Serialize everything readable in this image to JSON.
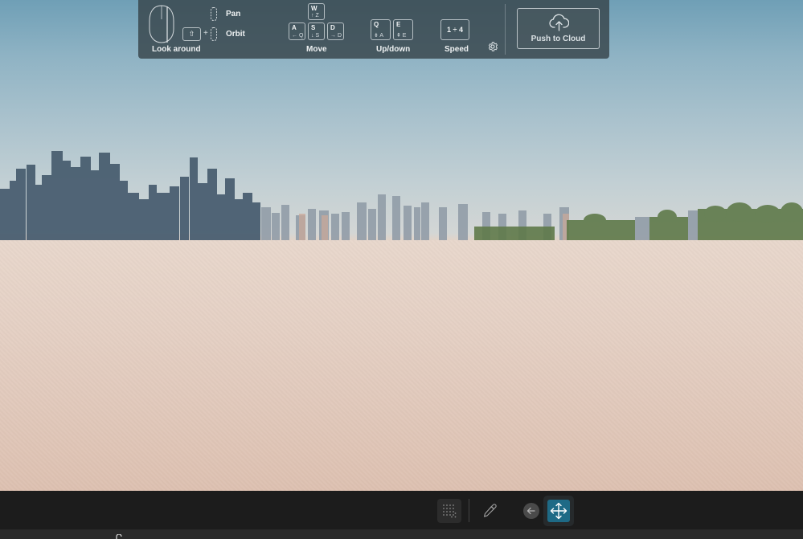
{
  "controls": {
    "look_around_label": "Look around",
    "pan_label": "Pan",
    "orbit_label": "Orbit",
    "plus_sign": "+",
    "modifier_glyph": "⇧",
    "move_label": "Move",
    "updown_label": "Up/down",
    "speed_label": "Speed",
    "keys": {
      "w": {
        "top": "W",
        "bottom": "↑ Z"
      },
      "a": {
        "top": "A",
        "bottom": "← Q"
      },
      "s": {
        "top": "S",
        "bottom": "↓ S"
      },
      "d": {
        "top": "D",
        "bottom": "→ D"
      },
      "q": {
        "top": "Q",
        "bottom": "⇟   A"
      },
      "e": {
        "top": "E",
        "bottom": "⇞      E"
      }
    },
    "speed_range": "1 ÷ 4",
    "settings_icon": "gear-icon",
    "push_to_cloud": {
      "label": "Push to Cloud",
      "icon": "cloud-upload-icon"
    }
  },
  "toolbar": {
    "items": [
      {
        "icon": "grid-dots-icon",
        "active": false
      },
      {
        "icon": "eyedropper-icon",
        "active": false
      },
      {
        "icon": "arrow-left-icon",
        "active": false
      },
      {
        "icon": "move-arrows-icon",
        "active": true
      }
    ]
  },
  "colors": {
    "accent": "#1e6a86",
    "overlay": "#37444b",
    "toolbar_bg": "#1c1c1c"
  }
}
